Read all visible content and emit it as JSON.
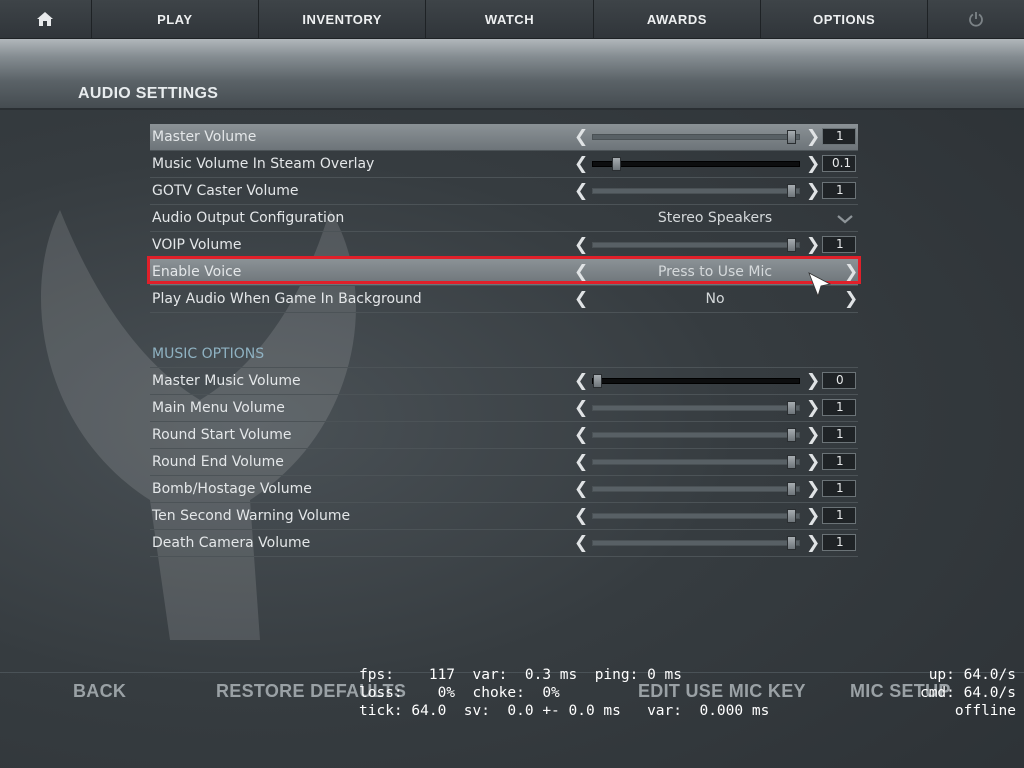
{
  "nav": {
    "items": [
      {
        "label": "PLAY"
      },
      {
        "label": "INVENTORY"
      },
      {
        "label": "WATCH"
      },
      {
        "label": "AWARDS"
      },
      {
        "label": "OPTIONS"
      }
    ]
  },
  "header": {
    "title": "AUDIO SETTINGS"
  },
  "audio_rows": [
    {
      "label": "Master Volume",
      "type": "slider",
      "value": "1",
      "level": 1.0
    },
    {
      "label": "Music Volume In Steam Overlay",
      "type": "slider",
      "value": "0.1",
      "level": 0.1
    },
    {
      "label": "GOTV Caster Volume",
      "type": "slider",
      "value": "1",
      "level": 1.0
    },
    {
      "label": "Audio Output Configuration",
      "type": "dropdown",
      "value": "Stereo Speakers"
    },
    {
      "label": "VOIP Volume",
      "type": "slider",
      "value": "1",
      "level": 1.0
    },
    {
      "label": "Enable Voice",
      "type": "choice",
      "value": "Press to Use Mic"
    },
    {
      "label": "Play Audio When Game In Background",
      "type": "choice",
      "value": "No"
    }
  ],
  "music": {
    "title": "MUSIC OPTIONS",
    "rows": [
      {
        "label": "Master Music Volume",
        "value": "0",
        "level": 0.0
      },
      {
        "label": "Main Menu Volume",
        "value": "1",
        "level": 1.0
      },
      {
        "label": "Round Start Volume",
        "value": "1",
        "level": 1.0
      },
      {
        "label": "Round End Volume",
        "value": "1",
        "level": 1.0
      },
      {
        "label": "Bomb/Hostage Volume",
        "value": "1",
        "level": 1.0
      },
      {
        "label": "Ten Second Warning Volume",
        "value": "1",
        "level": 1.0
      },
      {
        "label": "Death Camera Volume",
        "value": "1",
        "level": 1.0
      }
    ]
  },
  "bottom": {
    "back": "BACK",
    "restore": "RESTORE DEFAULTS",
    "edit_mic": "EDIT USE MIC KEY",
    "mic_setup": "MIC SETUP"
  },
  "netgraph": {
    "line1": "fps:    117  var:  0.3 ms  ping: 0 ms",
    "line2": "loss:    0%  choke:  0%",
    "line3": "tick: 64.0  sv:  0.0 +- 0.0 ms   var:  0.000 ms",
    "right1": "up: 64.0/s",
    "right2": "cmd: 64.0/s",
    "right3": "offline"
  },
  "icons": {
    "home": "home-icon",
    "power": "power-icon",
    "left": "chevron-left-icon",
    "right": "chevron-right-icon",
    "down": "chevron-down-icon",
    "cursor": "mouse-cursor-icon"
  },
  "colors": {
    "highlight_frame": "#e0202a",
    "section_title": "#8fb2c2"
  }
}
